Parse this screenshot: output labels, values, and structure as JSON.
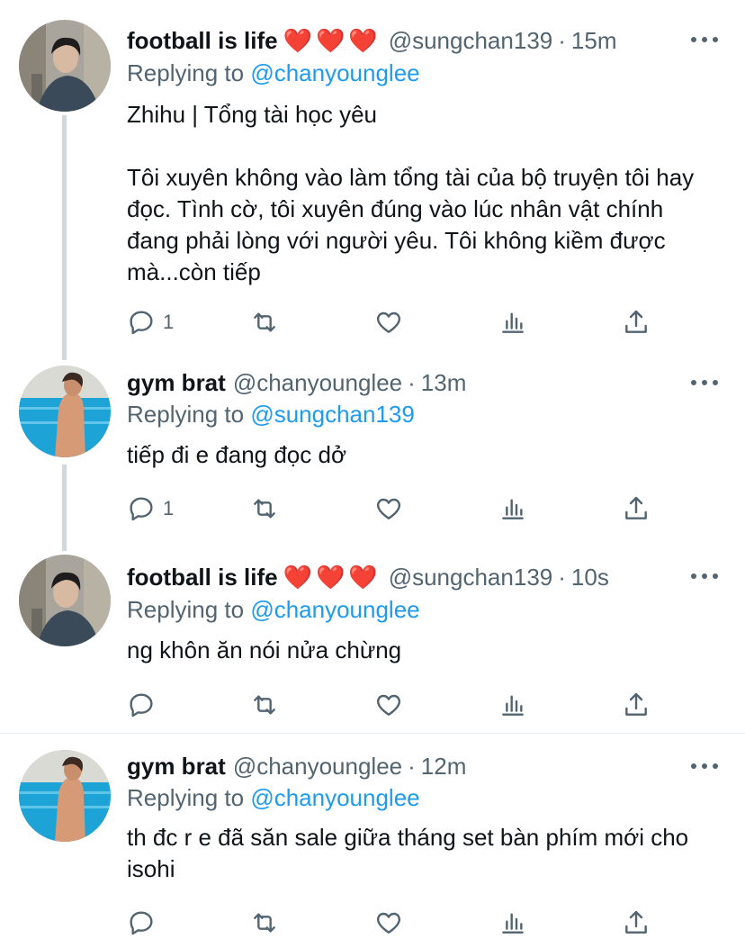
{
  "tweets": [
    {
      "name": "football is life",
      "hearts": "❤️❤️❤️",
      "handle": "@sungchan139",
      "time": "15m",
      "replying_prefix": "Replying to",
      "replying_to": "@chanyounglee",
      "text": "Zhihu | Tổng tài học yêu\n\nTôi xuyên không vào làm tổng tài của bộ truyện tôi hay đọc. Tình cờ, tôi xuyên đúng vào lúc nhân vật chính đang phải lòng với người yêu. Tôi không kiềm được mà...còn tiếp",
      "reply_count": "1"
    },
    {
      "name": "gym brat",
      "hearts": "",
      "handle": "@chanyounglee",
      "time": "13m",
      "replying_prefix": "Replying to",
      "replying_to": "@sungchan139",
      "text": "tiếp đi e đang đọc dở",
      "reply_count": "1"
    },
    {
      "name": "football is life",
      "hearts": "❤️❤️❤️",
      "handle": "@sungchan139",
      "time": "10s",
      "replying_prefix": "Replying to",
      "replying_to": "@chanyounglee",
      "text": "ng khôn ăn nói nửa chừng",
      "reply_count": ""
    },
    {
      "name": "gym brat",
      "hearts": "",
      "handle": "@chanyounglee",
      "time": "12m",
      "replying_prefix": "Replying to",
      "replying_to": "@chanyounglee",
      "text": "th đc r e đã săn sale giữa tháng set bàn phím mới cho isohi",
      "reply_count": ""
    }
  ],
  "colors": {
    "accent": "#1d9bf0",
    "secondary": "#536471",
    "heart": "#e0245e"
  },
  "icons": [
    "reply-icon",
    "retweet-icon",
    "like-icon",
    "analytics-icon",
    "share-icon",
    "more-icon"
  ]
}
